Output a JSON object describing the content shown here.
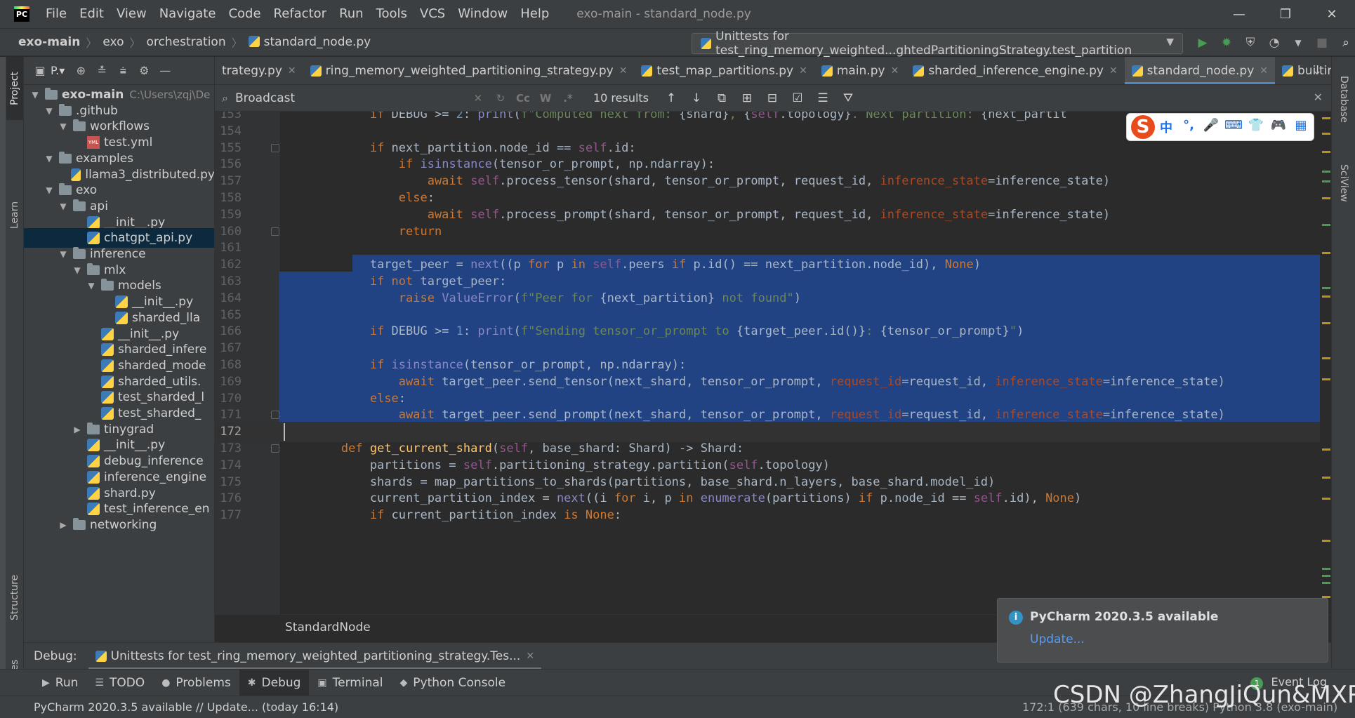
{
  "app": {
    "logo_text": "PC",
    "menu": [
      "File",
      "Edit",
      "View",
      "Navigate",
      "Code",
      "Refactor",
      "Run",
      "Tools",
      "VCS",
      "Window",
      "Help"
    ],
    "window_title": "exo-main - standard_node.py"
  },
  "navbar": {
    "crumbs": [
      "exo-main",
      "exo",
      "orchestration",
      "standard_node.py"
    ],
    "run_config": "Unittests for test_ring_memory_weighted...ghtedPartitioningStrategy.test_partition"
  },
  "left_strip": {
    "project": "Project",
    "learn": "Learn",
    "structure": "Structure",
    "favorites": "Favorites"
  },
  "right_strip": {
    "database": "Database",
    "sciview": "SciView"
  },
  "project_panel": {
    "view_label": "P.▾",
    "tree": [
      {
        "label": "exo-main",
        "path": "C:\\Users\\zqj\\De",
        "type": "folder",
        "indent": 0,
        "arrow": "▼",
        "bold": true
      },
      {
        "label": ".github",
        "type": "folder",
        "indent": 1,
        "arrow": "▼"
      },
      {
        "label": "workflows",
        "type": "folder",
        "indent": 2,
        "arrow": "▼"
      },
      {
        "label": "test.yml",
        "type": "yml",
        "indent": 3,
        "arrow": ""
      },
      {
        "label": "examples",
        "type": "folder",
        "indent": 1,
        "arrow": "▼"
      },
      {
        "label": "llama3_distributed.py",
        "type": "py",
        "indent": 2,
        "arrow": ""
      },
      {
        "label": "exo",
        "type": "folder",
        "indent": 1,
        "arrow": "▼"
      },
      {
        "label": "api",
        "type": "folder",
        "indent": 2,
        "arrow": "▼"
      },
      {
        "label": "__init__.py",
        "type": "py",
        "indent": 3,
        "arrow": ""
      },
      {
        "label": "chatgpt_api.py",
        "type": "py",
        "indent": 3,
        "arrow": "",
        "selected": true
      },
      {
        "label": "inference",
        "type": "folder",
        "indent": 2,
        "arrow": "▼"
      },
      {
        "label": "mlx",
        "type": "folder",
        "indent": 3,
        "arrow": "▼"
      },
      {
        "label": "models",
        "type": "folder",
        "indent": 4,
        "arrow": "▼"
      },
      {
        "label": "__init__.py",
        "type": "py",
        "indent": 5,
        "arrow": ""
      },
      {
        "label": "sharded_lla",
        "type": "py",
        "indent": 5,
        "arrow": ""
      },
      {
        "label": "__init__.py",
        "type": "py",
        "indent": 4,
        "arrow": ""
      },
      {
        "label": "sharded_infere",
        "type": "py",
        "indent": 4,
        "arrow": ""
      },
      {
        "label": "sharded_mode",
        "type": "py",
        "indent": 4,
        "arrow": ""
      },
      {
        "label": "sharded_utils.",
        "type": "py",
        "indent": 4,
        "arrow": ""
      },
      {
        "label": "test_sharded_l",
        "type": "py",
        "indent": 4,
        "arrow": ""
      },
      {
        "label": "test_sharded_",
        "type": "py",
        "indent": 4,
        "arrow": ""
      },
      {
        "label": "tinygrad",
        "type": "folder",
        "indent": 3,
        "arrow": "▶"
      },
      {
        "label": "__init__.py",
        "type": "py",
        "indent": 3,
        "arrow": ""
      },
      {
        "label": "debug_inference",
        "type": "py",
        "indent": 3,
        "arrow": ""
      },
      {
        "label": "inference_engine",
        "type": "py",
        "indent": 3,
        "arrow": ""
      },
      {
        "label": "shard.py",
        "type": "py",
        "indent": 3,
        "arrow": ""
      },
      {
        "label": "test_inference_en",
        "type": "py",
        "indent": 3,
        "arrow": ""
      },
      {
        "label": "networking",
        "type": "folder",
        "indent": 2,
        "arrow": "▶"
      }
    ]
  },
  "tabs": [
    {
      "label": "trategy.py",
      "active": false
    },
    {
      "label": "ring_memory_weighted_partitioning_strategy.py",
      "active": false
    },
    {
      "label": "test_map_partitions.py",
      "active": false
    },
    {
      "label": "main.py",
      "active": false
    },
    {
      "label": "sharded_inference_engine.py",
      "active": false
    },
    {
      "label": "standard_node.py",
      "active": true
    },
    {
      "label": "builtins.py",
      "active": false
    }
  ],
  "search": {
    "value": "Broadcast",
    "results": "10 results",
    "options": [
      "Cc",
      "W",
      ".*"
    ]
  },
  "editor": {
    "lines": [
      {
        "n": "153",
        "code": "    <span class='kw'>if</span> DEBUG >= <span class='nm'>2</span>: <span class='bi'>print</span>(<span class='st'>f\"Computed next from: </span>{shard}<span class='st'>, </span>{<span class='sf'>self</span>.topology}<span class='st'>. Next partition: </span>{next_partit"
      },
      {
        "n": "154",
        "code": ""
      },
      {
        "n": "155",
        "code": "    <span class='kw'>if</span> next_partition.node_id == <span class='sf'>self</span>.id:",
        "fold": true
      },
      {
        "n": "156",
        "code": "        <span class='kw'>if</span> <span class='bi'>isinstance</span>(tensor_or_prompt, np.ndarray):"
      },
      {
        "n": "157",
        "code": "            <span class='kw'>await</span> <span class='sf'>self</span>.process_tensor(shard, tensor_or_prompt, request_id, <span class='pr'>inference_state</span>=inference_state)"
      },
      {
        "n": "158",
        "code": "        <span class='kw'>else</span>:"
      },
      {
        "n": "159",
        "code": "            <span class='kw'>await</span> <span class='sf'>self</span>.process_prompt(shard, tensor_or_prompt, request_id, <span class='pr'>inference_state</span>=inference_state)"
      },
      {
        "n": "160",
        "code": "        <span class='kw'>return</span>",
        "fold": true
      },
      {
        "n": "161",
        "code": ""
      },
      {
        "n": "162",
        "code": "    target_peer = <span class='bi'>next</span>((p <span class='kw'>for</span> p <span class='kw'>in</span> <span class='sf'>self</span>.peers <span class='kw'>if</span> p.id() == next_partition.node_id), <span class='kw'>None</span>)",
        "sel": "partial"
      },
      {
        "n": "163",
        "code": "    <span class='kw'>if not</span> target_peer:",
        "sel": "full"
      },
      {
        "n": "164",
        "code": "        <span class='kw'>raise</span> <span class='bi'>ValueError</span>(<span class='st'>f\"Peer for </span>{next_partition}<span class='st'> not found\"</span>)",
        "sel": "full"
      },
      {
        "n": "165",
        "code": "",
        "sel": "full"
      },
      {
        "n": "166",
        "code": "    <span class='kw'>if</span> DEBUG >= <span class='nm'>1</span>: <span class='bi'>print</span>(<span class='st'>f\"Sending tensor_or_prompt to </span>{target_peer.id()}<span class='st'>: </span>{tensor_or_prompt}<span class='st'>\"</span>)",
        "sel": "full"
      },
      {
        "n": "167",
        "code": "",
        "sel": "full"
      },
      {
        "n": "168",
        "code": "    <span class='kw'>if</span> <span class='bi'>isinstance</span>(tensor_or_prompt, np.ndarray):",
        "sel": "full"
      },
      {
        "n": "169",
        "code": "        <span class='kw'>await</span> target_peer.send_tensor(next_shard, tensor_or_prompt, <span class='pr'>request_id</span>=request_id, <span class='pr'>inference_state</span>=inference_state)",
        "sel": "full"
      },
      {
        "n": "170",
        "code": "    <span class='kw'>else</span>:",
        "sel": "full"
      },
      {
        "n": "171",
        "code": "        <span class='kw'>await</span> target_peer.send_prompt(next_shard, tensor_or_prompt, <span class='pr'>request_id</span>=request_id, <span class='pr'>inference_state</span>=inference_state)",
        "sel": "full",
        "fold": true
      },
      {
        "n": "172",
        "code": "",
        "caret": true
      },
      {
        "n": "173",
        "code": "<span class='kw'>def</span> <span class='fn'>get_current_shard</span>(<span class='sf'>self</span>, base_shard: Shard) -> Shard:",
        "fold": true
      },
      {
        "n": "174",
        "code": "    partitions = <span class='sf'>self</span>.partitioning_strategy.partition(<span class='sf'>self</span>.topology)"
      },
      {
        "n": "175",
        "code": "    shards = map_partitions_to_shards(partitions, base_shard.n_layers, base_shard.model_id)"
      },
      {
        "n": "176",
        "code": "    current_partition_index = <span class='bi'>next</span>((i <span class='kw'>for</span> i, p <span class='kw'>in</span> <span class='bi'>enumerate</span>(partitions) <span class='kw'>if</span> p.node_id == <span class='sf'>self</span>.id), <span class='kw'>None</span>)"
      },
      {
        "n": "177",
        "code": "    <span class='kw'>if</span> current_partition_index <span class='kw'>is</span> <span class='kw'>None</span>:"
      }
    ],
    "struct_label": "StandardNode"
  },
  "ime": {
    "logo": "S",
    "items": [
      "中",
      "°,",
      "🎤",
      "⌨",
      "👕",
      "🎮",
      "▦"
    ]
  },
  "debug_bar": {
    "label": "Debug:",
    "tab": "Unittests for test_ring_memory_weighted_partitioning_strategy.Tes..."
  },
  "bottom_tabs": [
    {
      "icon": "▶",
      "label": "Run"
    },
    {
      "icon": "☰",
      "label": "TODO"
    },
    {
      "icon": "●",
      "label": "Problems"
    },
    {
      "icon": "✱",
      "label": "Debug",
      "active": true
    },
    {
      "icon": "▣",
      "label": "Terminal"
    },
    {
      "icon": "◆",
      "label": "Python Console"
    }
  ],
  "event_log": {
    "badge": "1",
    "label": "Event Log"
  },
  "status": {
    "text": "PyCharm 2020.3.5 available // Update... (today 16:14)",
    "right": "172:1 (639 chars, 10 line breaks)   Python 3.8 (exo-main)"
  },
  "notification": {
    "title": "PyCharm 2020.3.5 available",
    "link": "Update..."
  },
  "watermark": "CSDN @ZhangJiQun&MXP",
  "colors": {
    "selection": "#214283",
    "keyword": "#cc7832",
    "string": "#6a8759",
    "accent": "#4a88c7"
  }
}
